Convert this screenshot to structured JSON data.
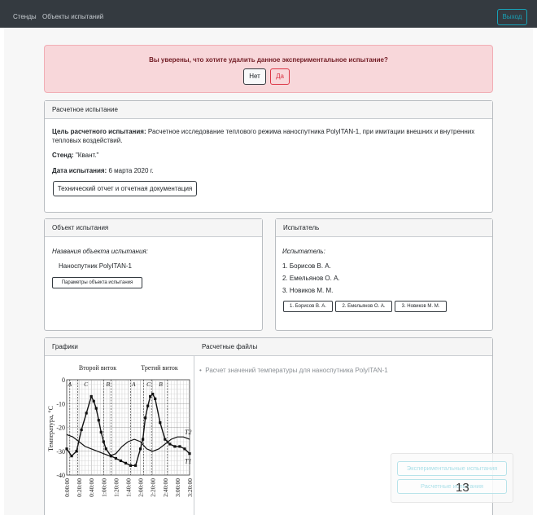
{
  "navbar": {
    "links": [
      "Стенды",
      "Объекты испытаний"
    ],
    "logout": "Выход"
  },
  "alert": {
    "message": "Вы уверены, что хотите удалить данное экспериментальное испытание?",
    "no_label": "Нет",
    "yes_label": "Да"
  },
  "test_card": {
    "header": "Расчетное испытание",
    "goal_label": "Цель расчетного испытания:",
    "goal_text_1": "Расчетное исследование теплового режима наноспутника PolyITAN-1, при имитации внешних и внутренних",
    "goal_text_2": "тепловых воздействий.",
    "stand_label": "Стенд:",
    "stand_value": "\"Квант.\"",
    "date_label": "Дата испытания:",
    "date_value": "6 марта 2020 г.",
    "report_button": "Технический отчет и отчетная документация"
  },
  "object_card": {
    "header": "Объект испытания",
    "names_label": "Названия объекта испытания:",
    "object_name": "Наноспутник PolyITAN-1",
    "params_button": "Параметры объекта испытания"
  },
  "tester_card": {
    "header": "Испытатель",
    "label": "Испытатель:",
    "testers": [
      "1. Борисов В. А.",
      "2. Емельянов О. А.",
      "3. Новиков М. М."
    ],
    "tester_buttons": [
      "1. Борисов В. А.",
      "2. Емельянов О. А.",
      "3. Новиков М. М."
    ]
  },
  "graphs_card": {
    "graphs_header": "Графики",
    "files_header": "Расчетные файлы",
    "files": [
      "Расчет значений температуры для наноспутника PolyITAN-1"
    ]
  },
  "chart_data": {
    "type": "line",
    "top_labels": [
      "Второй виток",
      "Третий виток"
    ],
    "ylabel": "Температура, °С",
    "ylim": [
      -40,
      0
    ],
    "yticks": [
      "0",
      "-10",
      "-20",
      "-30",
      "-40"
    ],
    "xticks": [
      "0:00:00",
      "0:20:00",
      "0:40:00",
      "1:00:00",
      "1:20:00",
      "1:40:00",
      "2:00:00",
      "2:20:00",
      "2:40:00",
      "3:00:00",
      "3:20:00"
    ],
    "zone_labels": [
      "A",
      "C",
      "B",
      "A",
      "C",
      "B"
    ],
    "series": [
      {
        "name": "T1",
        "x": [
          0,
          8,
          16,
          24,
          32,
          40,
          44,
          48,
          52,
          56,
          60,
          64,
          72,
          80,
          88,
          96,
          104,
          112,
          120,
          124,
          128,
          132,
          136,
          140,
          144,
          152,
          160,
          168,
          176,
          184,
          192,
          200
        ],
        "y": [
          -29,
          -32,
          -30,
          -21,
          -14,
          -7,
          -9,
          -12,
          -17,
          -22,
          -26,
          -29,
          -32,
          -33,
          -34,
          -35,
          -36,
          -36,
          -29,
          -25,
          -16,
          -11,
          -7,
          -6,
          -8,
          -18,
          -25,
          -27,
          -28,
          -28,
          -29,
          -31
        ]
      },
      {
        "name": "T2",
        "x": [
          0,
          10,
          20,
          30,
          40,
          50,
          60,
          70,
          80,
          90,
          100,
          110,
          120,
          130,
          140,
          150,
          160,
          170,
          180,
          190,
          200
        ],
        "y": [
          -23,
          -24,
          -26,
          -28,
          -29,
          -30,
          -31,
          -32,
          -31,
          -28,
          -26,
          -25,
          -26,
          -29,
          -30,
          -29,
          -27,
          -25,
          -24,
          -24,
          -25
        ]
      }
    ]
  },
  "floating_panel": {
    "buttons": [
      "Экспериментальные испытания",
      "Расчетные испытания"
    ]
  },
  "page_number": "13"
}
